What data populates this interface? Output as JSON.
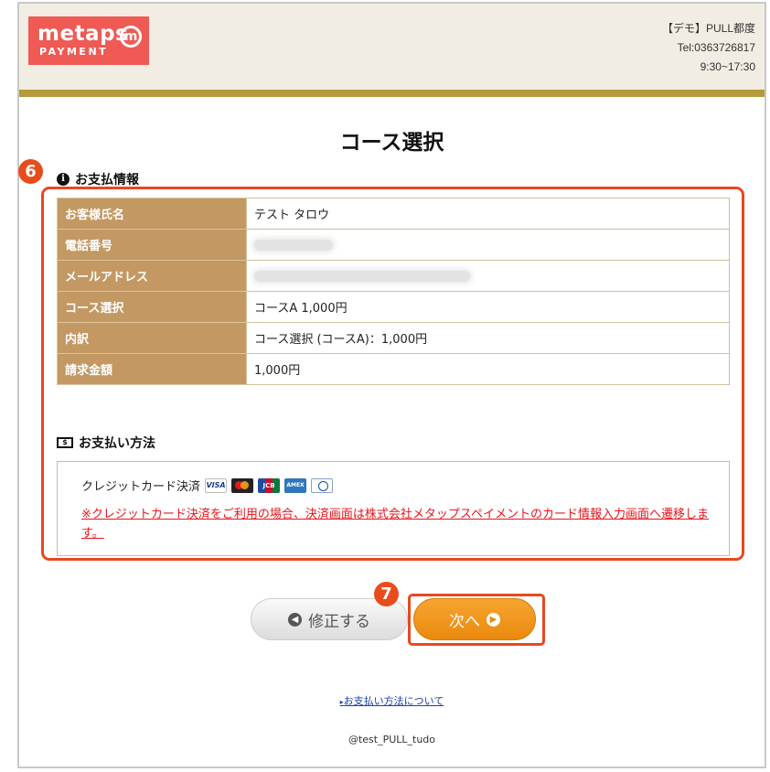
{
  "header": {
    "logo_top": "metaps",
    "logo_mark": "m",
    "logo_bottom": "PAYMENT",
    "merchant_name": "【デモ】PULL都度",
    "tel": "Tel:0363726817",
    "hours": "9:30~17:30"
  },
  "page_title": "コース選択",
  "badges": {
    "six": "6",
    "seven": "7"
  },
  "payment_info": {
    "title": "お支払情報",
    "icon": "info-circle-icon",
    "rows": [
      {
        "label": "お客様氏名",
        "value": "テスト タロウ"
      },
      {
        "label": "電話番号",
        "value": ""
      },
      {
        "label": "メールアドレス",
        "value": ""
      },
      {
        "label": "コース選択",
        "value": "コースA 1,000円"
      },
      {
        "label": "内訳",
        "value": "コース選択 (コースA)：1,000円"
      },
      {
        "label": "請求金額",
        "value": "1,000円"
      }
    ]
  },
  "payment_method": {
    "title": "お支払い方法",
    "icon": "money-icon",
    "card_label": "クレジットカード決済",
    "card_visa": "VISA",
    "card_jcb": "JCB",
    "card_amex": "AMEX",
    "note": "※クレジットカード決済をご利用の場合、決済画面は株式会社メタップスペイメントのカード情報入力画面へ遷移します。"
  },
  "buttons": {
    "back_label": "修正する",
    "next_label": "次へ"
  },
  "footer": {
    "link": "お支払い方法について",
    "account": "@test_PULL_tudo"
  },
  "colors": {
    "accent_orange": "#ea8a0d",
    "header_bar": "#b59a3c",
    "table_label_bg": "#c39863",
    "highlight": "#e8481f",
    "note_red": "#e8141b"
  }
}
